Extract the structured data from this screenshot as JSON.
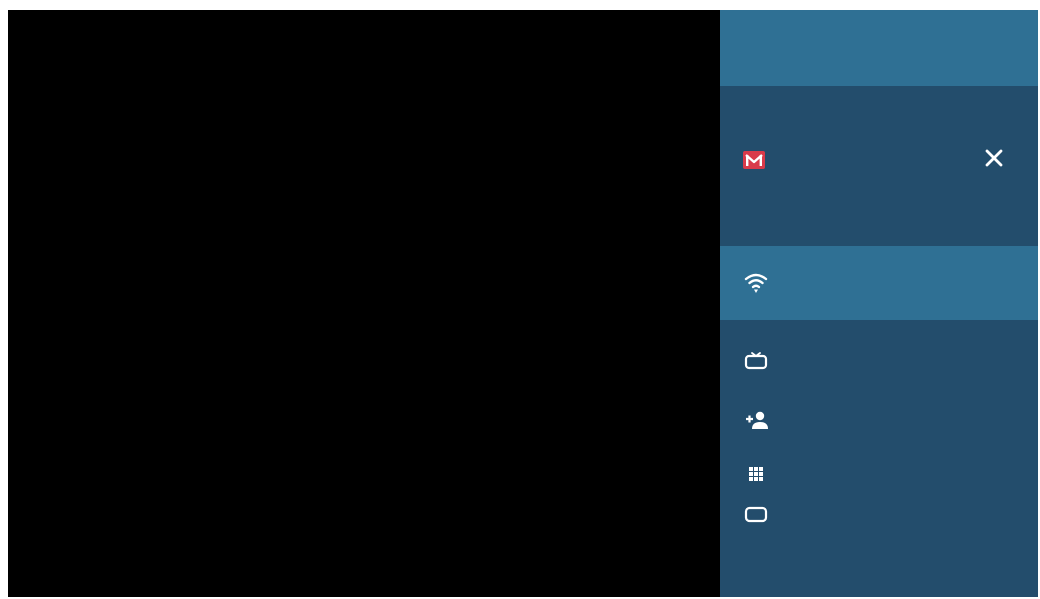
{
  "panel": {
    "header": {
      "icons": [
        "mail-icon",
        "close-icon"
      ]
    },
    "menu": {
      "items": [
        {
          "icon": "wifi-icon",
          "label": "",
          "active": true
        },
        {
          "icon": "tv-icon",
          "label": "",
          "active": false
        },
        {
          "icon": "add-person-icon",
          "label": "",
          "active": false
        },
        {
          "icon": "apps-grid-icon",
          "label": "",
          "active": false
        },
        {
          "icon": "screen-icon",
          "label": "",
          "active": false
        }
      ]
    }
  },
  "colors": {
    "background": "#000000",
    "panel": "#234d6c",
    "panel_highlight": "#2f7094",
    "mail_accent": "#d93a4a",
    "icon": "#ffffff"
  }
}
